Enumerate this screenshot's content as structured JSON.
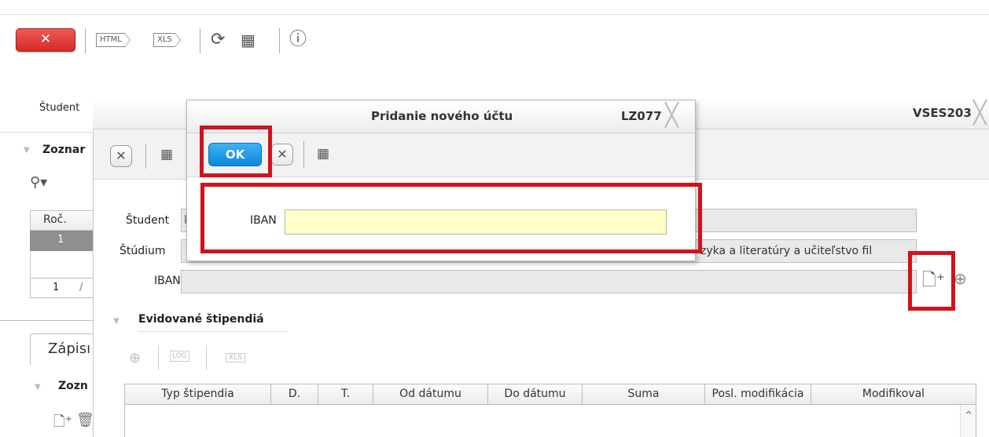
{
  "toolbar": {
    "close_label": "✕",
    "html_label": "HTML",
    "xls_label": "XLS",
    "refresh_glyph": "⟳",
    "grid_glyph": "▦",
    "info_glyph": "ⓘ"
  },
  "back_window": {
    "student_label": "Študent",
    "section_label": "Zoznar",
    "run_glyph": "⚲▾",
    "col_header": "Roč.",
    "row_value": "1",
    "pager_value": "1",
    "pager_sep": "/",
    "tab_label": "Zápisı",
    "subsection_label": "Zozn",
    "newdoc_glyph": "🗋⁺",
    "trash_glyph": "🗑"
  },
  "mid_window": {
    "title": "VSES203",
    "student_label": "Študent",
    "student_value": "l",
    "study_label": "Štúdium",
    "study_value": "zyka a literatúry a učiteľstvo fil",
    "iban_label": "IBAN",
    "newdoc_glyph": "🗋⁺",
    "zoom_glyph": "⊕",
    "section_label": "Evidované štipendiá",
    "section_buttons": {
      "zoom": "⊕",
      "log": "LOG",
      "xls": "XLS"
    },
    "table": {
      "headers": [
        "Typ štipendia",
        "D.",
        "T.",
        "Od dátumu",
        "Do dátumu",
        "Suma",
        "Posl. modifikácia",
        "Modifikoval"
      ]
    }
  },
  "dialog": {
    "title": "Pridanie nového účtu",
    "code": "LZ077",
    "ok_label": "OK",
    "cancel_glyph": "✕",
    "grid_glyph": "▦",
    "iban_label": "IBAN",
    "iban_value": ""
  },
  "colors": {
    "annotation_red": "#d4111b",
    "ok_blue": "#1a97e8",
    "close_red": "#e0403b",
    "iban_input": "#ffffc8"
  }
}
